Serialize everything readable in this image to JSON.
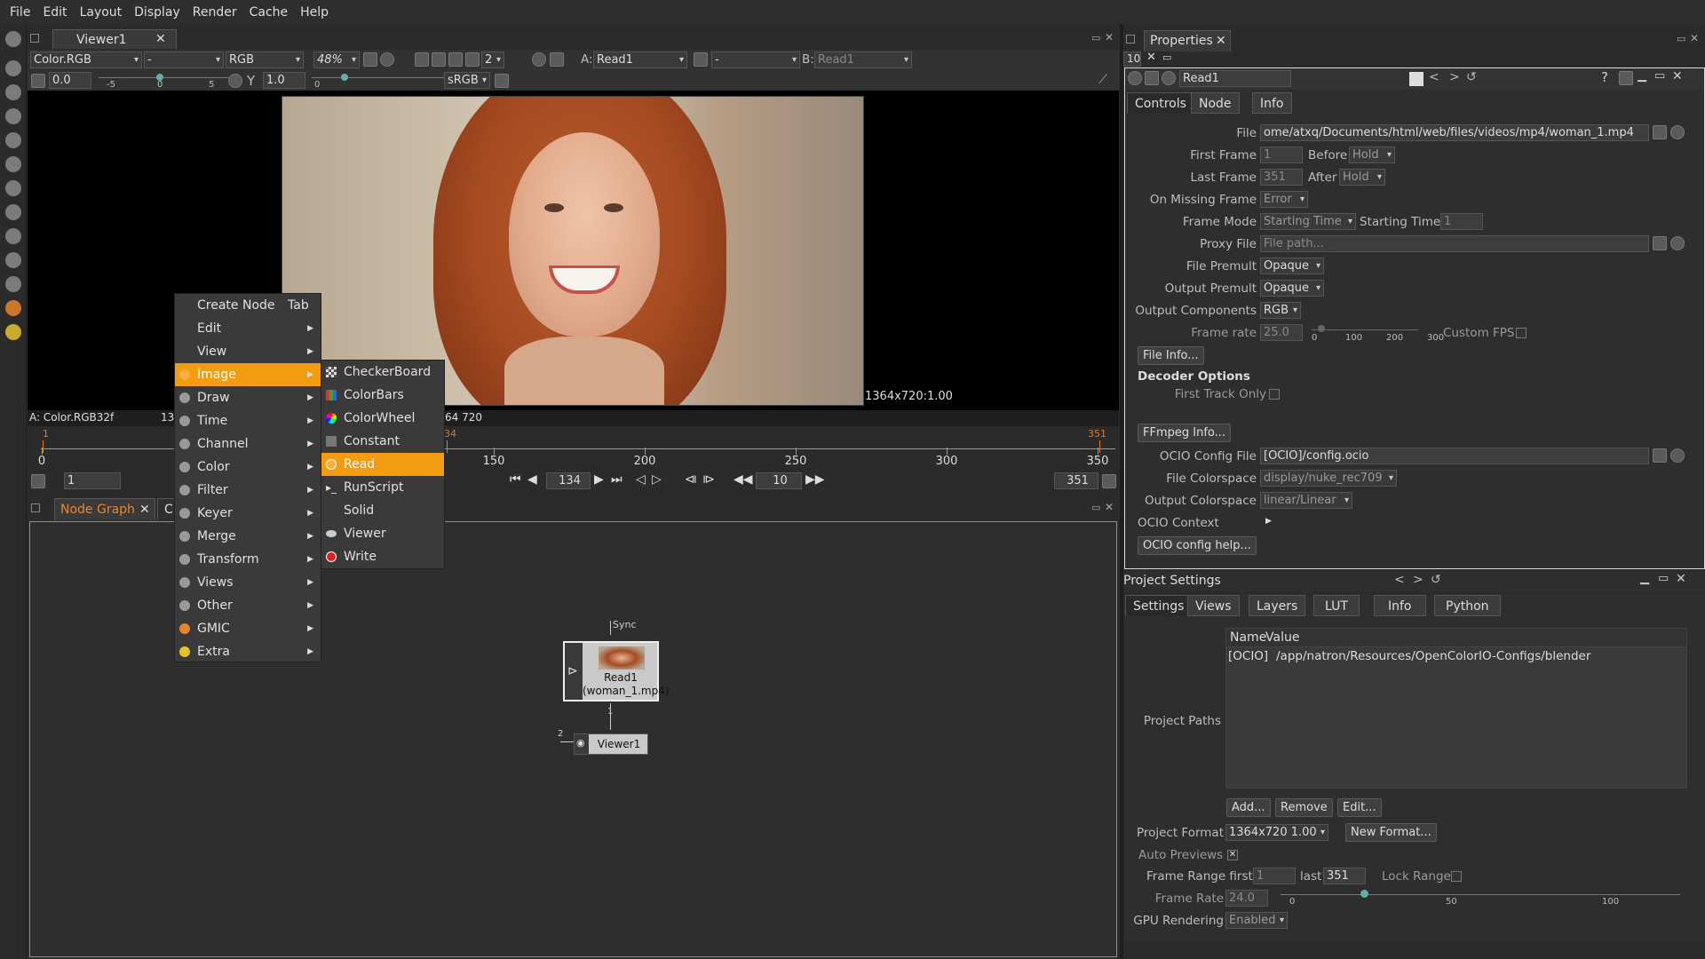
{
  "menubar": [
    "File",
    "Edit",
    "Layout",
    "Display",
    "Render",
    "Cache",
    "Help"
  ],
  "viewer": {
    "tab": "Viewer1",
    "channels": "Color.RGB",
    "layer": "-",
    "display": "RGB",
    "zoom": "48%",
    "subsample": "2",
    "input_a_label": "A:",
    "input_a": "Read1",
    "op": "-",
    "input_b_label": "B:",
    "input_b": "Read1",
    "gain": "0.0",
    "gamma_label": "Y",
    "gamma": "1.0",
    "colorspace": "sRGB",
    "gain_ticks": [
      "-5",
      "0",
      "5"
    ],
    "gamma_ticks": [
      "0"
    ],
    "resolution": "1364x720:1.00",
    "info_left": "A: Color.RGB32f",
    "info_left2": "13",
    "info_right": "64 720"
  },
  "timeline": {
    "start_marker": "1",
    "current_marker": "34",
    "end_marker": "351",
    "ticks": [
      "0",
      "150",
      "200",
      "250",
      "300",
      "350"
    ],
    "first": "1",
    "current": "134",
    "step": "10",
    "last": "351"
  },
  "nodegraph": {
    "tab": "Node Graph",
    "tab2": "C",
    "read_node": {
      "label": "Read1",
      "sub": "(woman_1.mp4)"
    },
    "viewer_node": {
      "label": "Viewer1"
    },
    "sync": "Sync",
    "pipe1": "1",
    "pipe2": "2"
  },
  "context_menu": {
    "items": [
      {
        "label": "Create Node",
        "shortcut": "Tab",
        "icon": ""
      },
      {
        "label": "Edit",
        "icon": ""
      },
      {
        "label": "View",
        "icon": ""
      },
      {
        "label": "Image",
        "icon": "image-icon",
        "highlight": true
      },
      {
        "label": "Draw",
        "icon": "draw-icon"
      },
      {
        "label": "Time",
        "icon": "time-icon"
      },
      {
        "label": "Channel",
        "icon": "channel-icon"
      },
      {
        "label": "Color",
        "icon": "color-icon"
      },
      {
        "label": "Filter",
        "icon": "filter-icon"
      },
      {
        "label": "Keyer",
        "icon": "keyer-icon"
      },
      {
        "label": "Merge",
        "icon": "merge-icon"
      },
      {
        "label": "Transform",
        "icon": "transform-icon"
      },
      {
        "label": "Views",
        "icon": "views-icon"
      },
      {
        "label": "Other",
        "icon": "other-icon"
      },
      {
        "label": "GMIC",
        "icon": "gmic-icon"
      },
      {
        "label": "Extra",
        "icon": "extra-icon"
      }
    ],
    "submenu": [
      {
        "label": "CheckerBoard",
        "icon": "checkerboard-icon"
      },
      {
        "label": "ColorBars",
        "icon": "colorbars-icon"
      },
      {
        "label": "ColorWheel",
        "icon": "colorwheel-icon"
      },
      {
        "label": "Constant",
        "icon": "constant-icon"
      },
      {
        "label": "Read",
        "icon": "read-icon",
        "highlight": true
      },
      {
        "label": "RunScript",
        "icon": "runscript-icon"
      },
      {
        "label": "Solid",
        "icon": ""
      },
      {
        "label": "Viewer",
        "icon": "viewer-icon"
      },
      {
        "label": "Write",
        "icon": "write-icon"
      }
    ]
  },
  "properties": {
    "tab": "Properties",
    "max": "10",
    "node_name": "Read1",
    "tabs": [
      "Controls",
      "Node",
      "Info"
    ],
    "file_label": "File",
    "file": "ome/atxq/Documents/html/web/files/videos/mp4/woman_1.mp4",
    "first_frame_label": "First Frame",
    "first_frame": "1",
    "before_label": "Before",
    "before": "Hold",
    "last_frame_label": "Last Frame",
    "last_frame": "351",
    "after_label": "After",
    "after": "Hold",
    "missing_label": "On Missing Frame",
    "missing": "Error",
    "frame_mode_label": "Frame Mode",
    "frame_mode": "Starting Time",
    "start_time_label": "Starting Time",
    "start_time": "1",
    "proxy_label": "Proxy File",
    "proxy_placeholder": "File path...",
    "file_premult_label": "File Premult",
    "file_premult": "Opaque",
    "output_premult_label": "Output Premult",
    "output_premult": "Opaque",
    "output_comp_label": "Output Components",
    "output_comp": "RGB",
    "frame_rate_label": "Frame rate",
    "frame_rate": "25.0",
    "fr_ticks": [
      "0",
      "100",
      "200",
      "300"
    ],
    "custom_fps": "Custom FPS",
    "file_info_btn": "File Info...",
    "decoder_header": "Decoder Options",
    "first_track": "First Track Only",
    "ffmpeg_btn": "FFmpeg Info...",
    "ocio_config_label": "OCIO Config File",
    "ocio_config": "[OCIO]/config.ocio",
    "file_cs_label": "File Colorspace",
    "file_cs": "display/nuke_rec709",
    "out_cs_label": "Output Colorspace",
    "out_cs": "linear/Linear",
    "ocio_context": "OCIO Context",
    "ocio_help_btn": "OCIO config help..."
  },
  "project": {
    "title": "Project Settings",
    "tabs": [
      "Settings",
      "Views",
      "Layers",
      "LUT",
      "Info",
      "Python"
    ],
    "col_name": "Name",
    "col_value": "Value",
    "row_name": "[OCIO]",
    "row_value": "/app/natron/Resources/OpenColorIO-Configs/blender",
    "paths_label": "Project Paths",
    "add": "Add...",
    "remove": "Remove",
    "edit": "Edit...",
    "format_label": "Project Format",
    "format": "1364x720 1.00",
    "new_format": "New Format...",
    "auto_previews": "Auto Previews",
    "range_label": "Frame Range first",
    "range_first": "1",
    "range_last_label": "last",
    "range_last": "351",
    "lock_range": "Lock Range",
    "rate_label": "Frame Rate",
    "rate": "24.0",
    "rate_ticks": [
      "0",
      "50",
      "100"
    ],
    "gpu_label": "GPU Rendering",
    "gpu": "Enabled"
  }
}
